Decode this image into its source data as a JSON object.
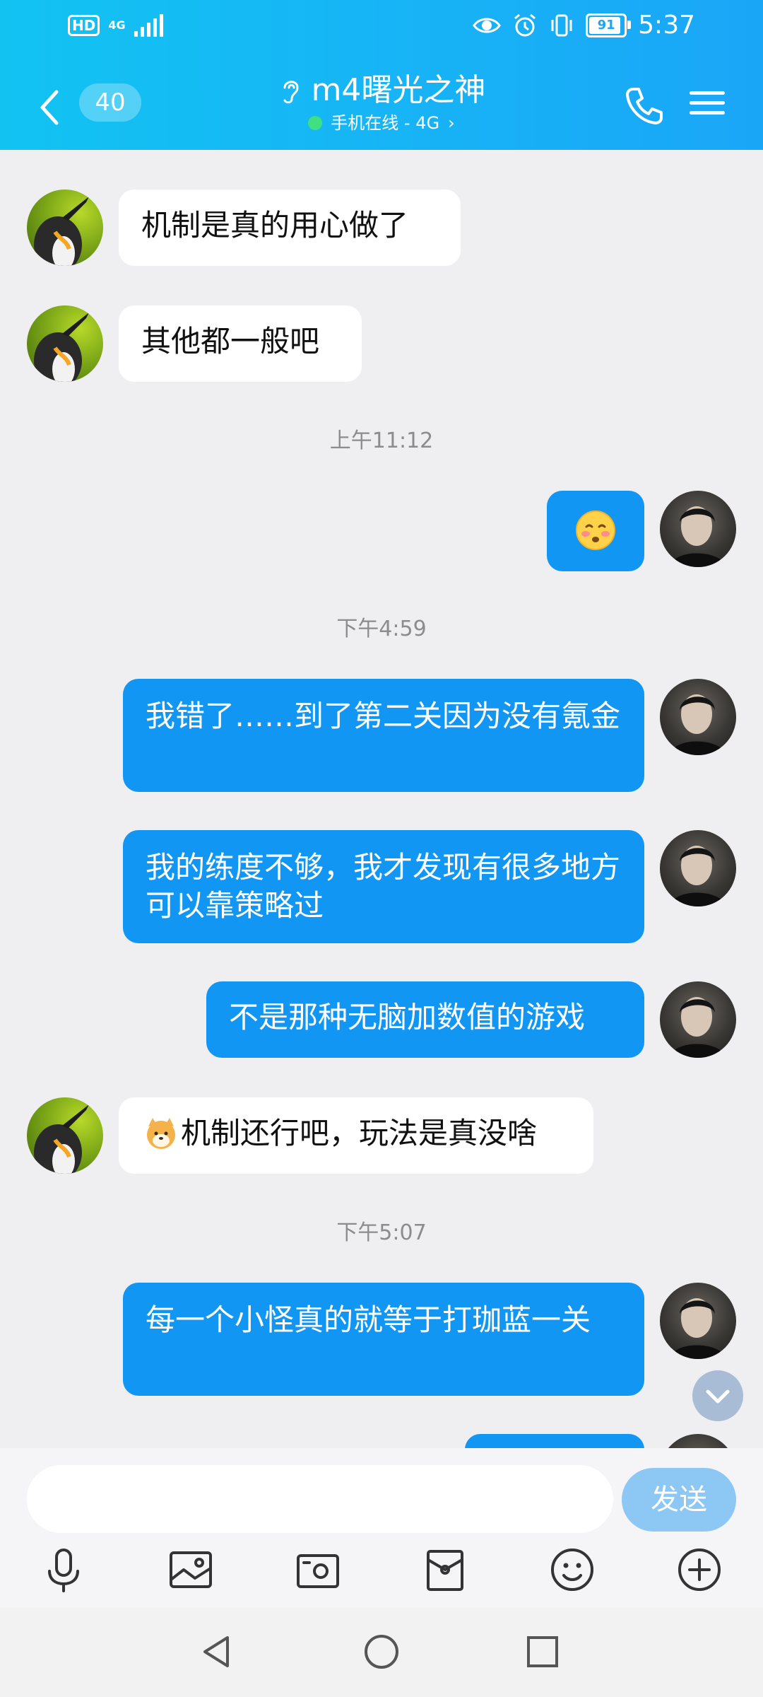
{
  "status_bar": {
    "hd_label": "HD",
    "network_label": "4G",
    "battery_level": "91",
    "time": "5:37"
  },
  "header": {
    "unread_count": "40",
    "contact_name": "m4曙光之神",
    "status_text": "手机在线 - 4G",
    "status_chevron": "›"
  },
  "messages": [
    {
      "side": "in",
      "text": "机制是真的用心做了"
    },
    {
      "side": "in",
      "text": "其他都一般吧"
    },
    {
      "type": "time",
      "text": "上午11:12"
    },
    {
      "side": "out",
      "emoji": "blushing-face-emoji"
    },
    {
      "type": "time",
      "text": "下午4:59"
    },
    {
      "side": "out",
      "text": "我错了……到了第二关因为没有氪金"
    },
    {
      "side": "out",
      "text": "我的练度不够，我才发现有很多地方可以靠策略过"
    },
    {
      "side": "out",
      "text": "不是那种无脑加数值的游戏"
    },
    {
      "side": "in",
      "emoji": "shiba-dog-emoji",
      "text": "机制还行吧，玩法是真没啥"
    },
    {
      "type": "time",
      "text": "下午5:07"
    },
    {
      "side": "out",
      "text": "每一个小怪真的就等于打珈蓝一关"
    }
  ],
  "input": {
    "value": "",
    "send_label": "发送"
  },
  "toolbar": [
    "microphone-icon",
    "image-icon",
    "camera-icon",
    "red-packet-icon",
    "emoji-icon",
    "plus-icon"
  ],
  "navigation": [
    "back-icon",
    "home-icon",
    "recents-icon"
  ],
  "colors": {
    "header_gradient_start": "#12c3f2",
    "header_gradient_end": "#1aa6f7",
    "outgoing_bubble": "#1296f3",
    "incoming_bubble": "#ffffff",
    "chat_background": "#efeff1",
    "online_dot": "#3ee07f",
    "send_button": "#8cc8f3"
  }
}
